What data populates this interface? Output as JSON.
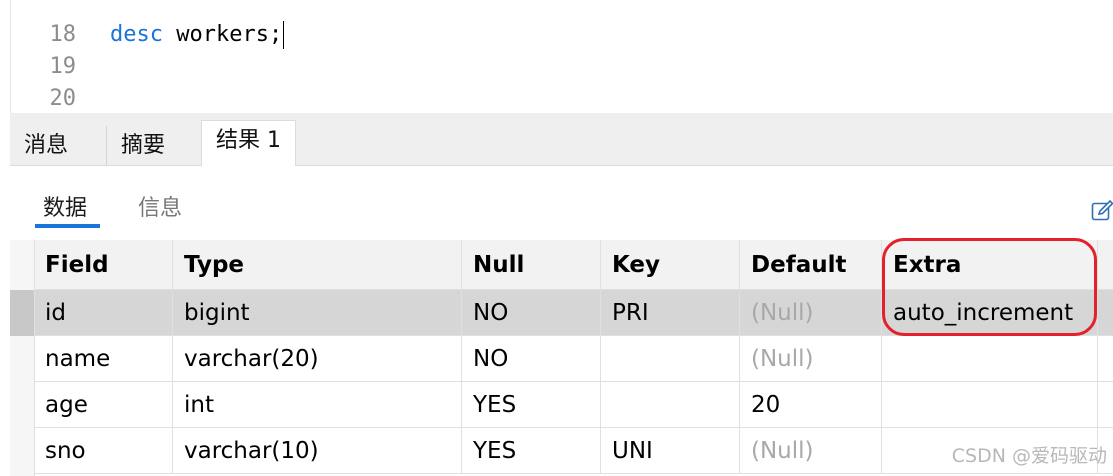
{
  "editor": {
    "lines": [
      {
        "number": "18",
        "keyword": "desc",
        "rest": " workers;"
      },
      {
        "number": "19",
        "keyword": "",
        "rest": ""
      },
      {
        "number": "20",
        "keyword": "",
        "rest": ""
      }
    ]
  },
  "result_tabs": [
    "消息",
    "摘要",
    "结果 1"
  ],
  "active_result_tab": "结果 1",
  "sub_tabs": [
    "数据",
    "信息"
  ],
  "active_sub_tab": "数据",
  "table": {
    "columns": [
      "Field",
      "Type",
      "Null",
      "Key",
      "Default",
      "Extra"
    ],
    "rows": [
      [
        "id",
        "bigint",
        "NO",
        "PRI",
        "(Null)",
        "auto_increment"
      ],
      [
        "name",
        "varchar(20)",
        "NO",
        "",
        "(Null)",
        ""
      ],
      [
        "age",
        "int",
        "YES",
        "",
        "20",
        ""
      ],
      [
        "sno",
        "varchar(10)",
        "YES",
        "UNI",
        "(Null)",
        ""
      ]
    ],
    "selected_row": 0
  },
  "watermark": "CSDN @爱码驱动",
  "colors": {
    "keyword": "#1a74d9",
    "tab_underline": "#1a74d9",
    "selected_row_bg": "#d6d6d6",
    "header_bg": "#f2f2f2",
    "annotation": "#e3202b",
    "null_text": "#a8a8a8"
  },
  "icons": [
    "edit-icon"
  ]
}
